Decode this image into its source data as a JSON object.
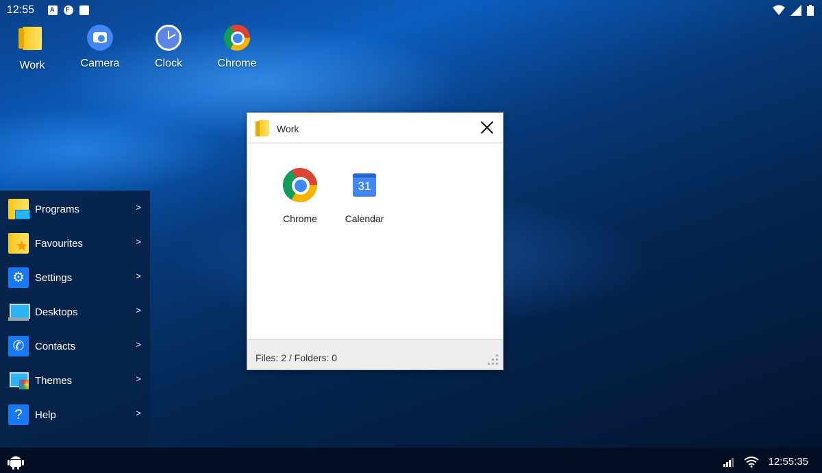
{
  "status_bar": {
    "time": "12:55",
    "notification_icons": [
      "font-icon",
      "app-f-icon",
      "sd-card-icon"
    ],
    "right_icons": [
      "wifi-icon",
      "signal-icon",
      "battery-icon"
    ]
  },
  "desktop": {
    "icons": [
      {
        "label": "Work",
        "icon": "folder-icon"
      },
      {
        "label": "Camera",
        "icon": "camera-icon"
      },
      {
        "label": "Clock",
        "icon": "clock-icon"
      },
      {
        "label": "Chrome",
        "icon": "chrome-icon"
      }
    ]
  },
  "window": {
    "title": "Work",
    "files": [
      {
        "label": "Chrome",
        "icon": "chrome-icon"
      },
      {
        "label": "Calendar",
        "icon": "calendar-icon",
        "day": "31"
      }
    ],
    "status": "Files: 2 / Folders: 0"
  },
  "start_menu": {
    "items": [
      {
        "label": "Programs",
        "arrow": ">"
      },
      {
        "label": "Favourites",
        "arrow": ">"
      },
      {
        "label": "Settings",
        "arrow": ">"
      },
      {
        "label": "Desktops",
        "arrow": ">"
      },
      {
        "label": "Contacts",
        "arrow": ">"
      },
      {
        "label": "Themes",
        "arrow": ">"
      },
      {
        "label": "Help",
        "arrow": ">"
      }
    ]
  },
  "taskbar": {
    "clock": "12:55:35"
  },
  "colors": {
    "accent": "#1877f2",
    "taskbar": "#020f23",
    "menu_bg": "#062248"
  }
}
